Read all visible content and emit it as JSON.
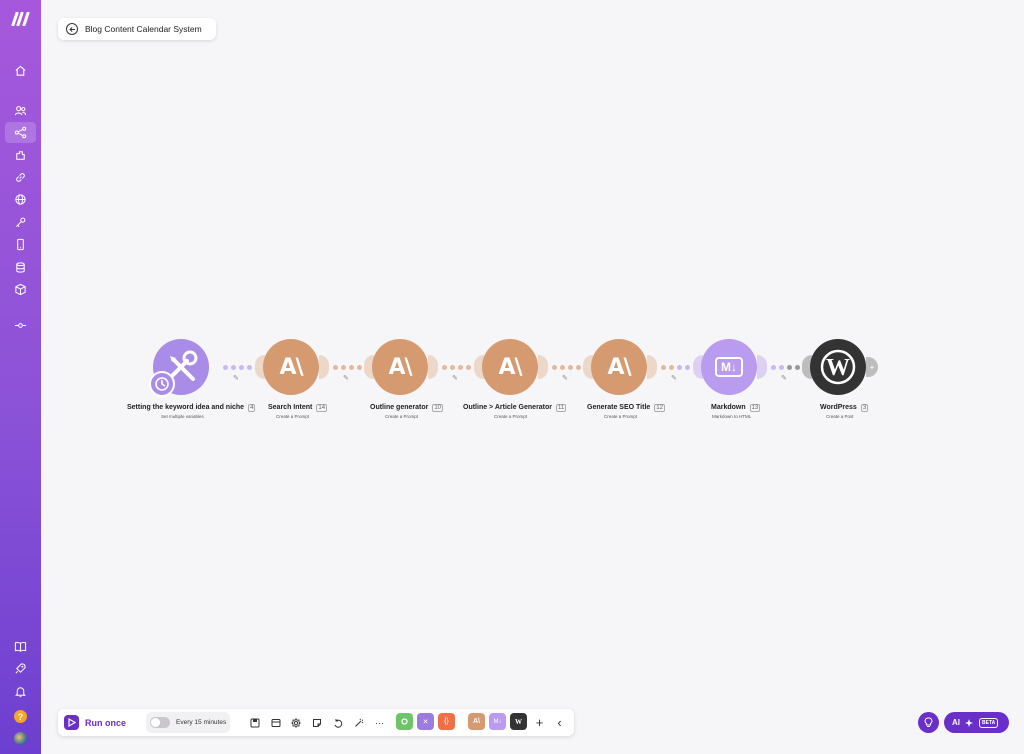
{
  "app": {
    "title": "Blog Content Calendar System"
  },
  "sidebar": {
    "items": [
      {
        "icon": "home-icon"
      },
      {
        "icon": "team-icon"
      },
      {
        "icon": "scenarios-icon",
        "active": true
      },
      {
        "icon": "templates-icon"
      },
      {
        "icon": "connections-icon"
      },
      {
        "icon": "webhooks-icon"
      },
      {
        "icon": "keys-icon"
      },
      {
        "icon": "devices-icon"
      },
      {
        "icon": "data-stores-icon"
      },
      {
        "icon": "data-structures-icon"
      },
      {
        "icon": "flow-control-icon"
      }
    ],
    "bottom": [
      {
        "icon": "docs-icon"
      },
      {
        "icon": "rocket-icon"
      },
      {
        "icon": "bell-icon"
      },
      {
        "icon": "help-icon",
        "label": "?"
      },
      {
        "icon": "avatar"
      }
    ]
  },
  "flow": {
    "modules": [
      {
        "label": "Setting the keyword idea and niche",
        "number": "4",
        "sub": "Set multiple variables",
        "kind": "tools"
      },
      {
        "label": "Search Intent",
        "number": "14",
        "sub": "Create a Prompt",
        "kind": "claude"
      },
      {
        "label": "Outline generator",
        "number": "10",
        "sub": "Create a Prompt",
        "kind": "claude"
      },
      {
        "label": "Outline > Article Generator",
        "number": "11",
        "sub": "Create a Prompt",
        "kind": "claude"
      },
      {
        "label": "Generate SEO Title",
        "number": "12",
        "sub": "Create a Prompt",
        "kind": "claude"
      },
      {
        "label": "Markdown",
        "number": "13",
        "sub": "Markdown to HTML",
        "kind": "markdown"
      },
      {
        "label": "WordPress",
        "number": "3",
        "sub": "Create a Post",
        "kind": "wordpress"
      }
    ],
    "claude_glyph": "A\\",
    "markdown_glyph": "M↓",
    "add_glyph": "+"
  },
  "toolbar": {
    "run_label": "Run once",
    "schedule_label": "Every 15 minutes",
    "tools_glyph": "✕",
    "code_glyph": "{}",
    "claude_glyph": "A\\",
    "md_glyph": "M↓",
    "wp_glyph": "W",
    "add_glyph": "+",
    "collapse_glyph": "‹",
    "more_glyph": "···"
  },
  "assist": {
    "ai_label": "AI",
    "beta_label": "BETA"
  },
  "colors": {
    "accent": "#6a2ec9",
    "claude": "#d59a70",
    "tools": "#a98be8",
    "markdown": "#b99bef",
    "wordpress": "#333333"
  }
}
